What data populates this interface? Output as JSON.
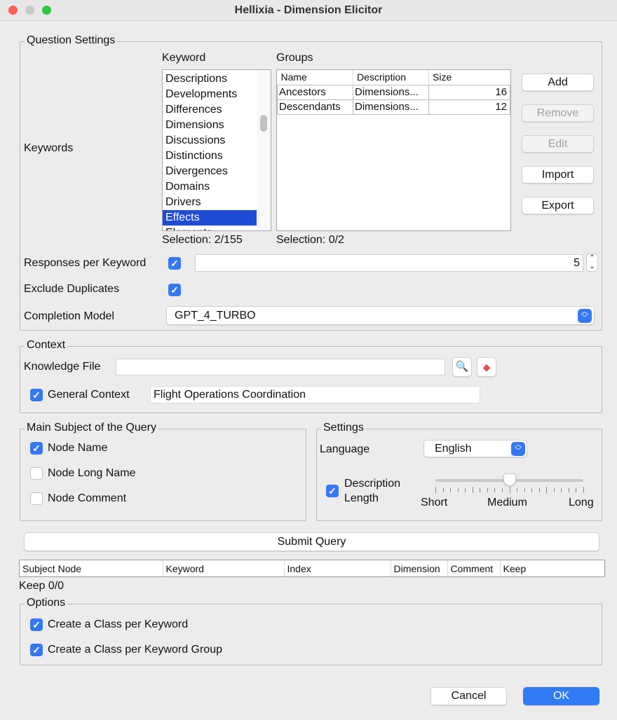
{
  "window": {
    "title": "Hellixia - Dimension Elicitor"
  },
  "question_settings": {
    "legend": "Question Settings",
    "keywords_label": "Keywords",
    "keyword_header": "Keyword",
    "groups_header": "Groups",
    "keywords": [
      "Descriptions",
      "Developments",
      "Differences",
      "Dimensions",
      "Discussions",
      "Distinctions",
      "Divergences",
      "Domains",
      "Drivers",
      "Effects",
      "Elements"
    ],
    "selected_keyword": "Effects",
    "keyword_selection": "Selection: 2/155",
    "groups_columns": [
      "Name",
      "Description",
      "Size"
    ],
    "groups_rows": [
      [
        "Ancestors",
        "Dimensions...",
        "16"
      ],
      [
        "Descendants",
        "Dimensions...",
        "12"
      ]
    ],
    "groups_selection": "Selection: 0/2",
    "buttons": {
      "add": "Add",
      "remove": "Remove",
      "edit": "Edit",
      "import": "Import",
      "export": "Export"
    },
    "responses_label": "Responses per Keyword",
    "responses_value": "5",
    "exclude_duplicates_label": "Exclude Duplicates",
    "completion_model_label": "Completion Model",
    "completion_model": "GPT_4_TURBO"
  },
  "context": {
    "legend": "Context",
    "knowledge_file_label": "Knowledge File",
    "knowledge_file_value": "",
    "general_context_label": "General Context",
    "general_context_value": "Flight Operations Coordination"
  },
  "main_subject": {
    "legend": "Main Subject of the Query",
    "node_name": "Node Name",
    "node_long_name": "Node Long Name",
    "node_comment": "Node Comment"
  },
  "settings": {
    "legend": "Settings",
    "language_label": "Language",
    "language": "English",
    "description_length_label_1": "Description",
    "description_length_label_2": "Length",
    "slider_labels": [
      "Short",
      "Medium",
      "Long"
    ],
    "slider_value": 0.5
  },
  "submit_label": "Submit Query",
  "results": {
    "columns": [
      "Subject Node",
      "Keyword",
      "Index",
      "Dimension",
      "Comment",
      "Keep"
    ],
    "keep_count": "Keep 0/0"
  },
  "options": {
    "legend": "Options",
    "class_per_keyword": "Create a Class per Keyword",
    "class_per_group": "Create a Class per Keyword Group"
  },
  "footer": {
    "cancel": "Cancel",
    "ok": "OK"
  },
  "colors": {
    "accent": "#3478f6",
    "selection": "#1f4bd6"
  }
}
